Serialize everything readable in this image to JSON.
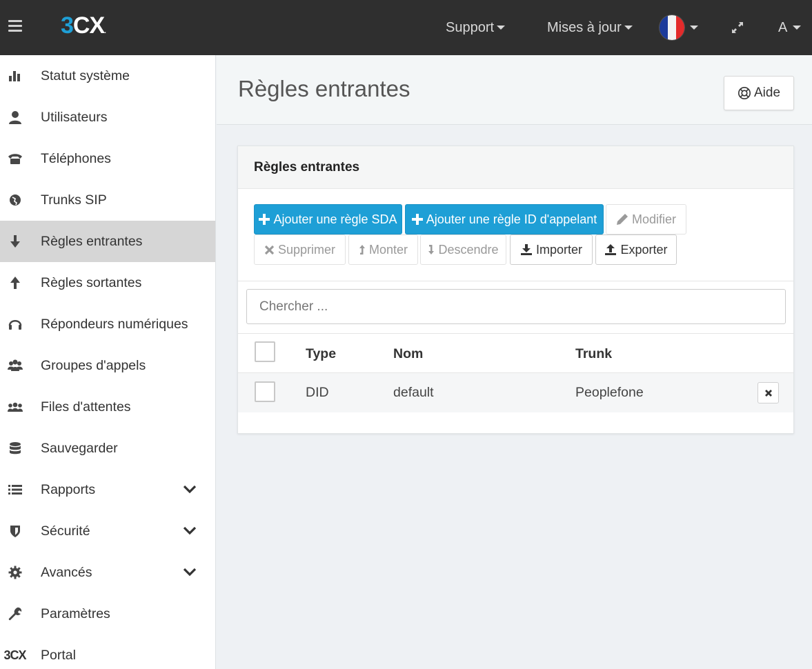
{
  "topbar": {
    "logo_prefix": "3",
    "logo_text": "CX",
    "logo_dot": ".",
    "support_label": "Support",
    "updates_label": "Mises à jour",
    "user_label": "A",
    "language_flag": "fr-flag-icon"
  },
  "sidebar": {
    "items": [
      {
        "label": "Statut système",
        "icon": "bar-chart-icon"
      },
      {
        "label": "Utilisateurs",
        "icon": "user-icon"
      },
      {
        "label": "Téléphones",
        "icon": "phone-icon"
      },
      {
        "label": "Trunks SIP",
        "icon": "globe-icon"
      },
      {
        "label": "Règles entrantes",
        "icon": "arrow-down-icon",
        "active": true
      },
      {
        "label": "Règles sortantes",
        "icon": "arrow-up-icon"
      },
      {
        "label": "Répondeurs numériques",
        "icon": "headset-icon"
      },
      {
        "label": "Groupes d'appels",
        "icon": "group-icon"
      },
      {
        "label": "Files d'attentes",
        "icon": "queue-icon"
      },
      {
        "label": "Sauvegarder",
        "icon": "database-icon"
      },
      {
        "label": "Rapports",
        "icon": "list-icon",
        "expandable": true
      },
      {
        "label": "Sécurité",
        "icon": "shield-icon",
        "expandable": true
      },
      {
        "label": "Avancés",
        "icon": "gear-icon",
        "expandable": true
      },
      {
        "label": "Paramètres",
        "icon": "wrench-icon"
      },
      {
        "label": "Portal",
        "icon": "3cx-logo-icon",
        "icon_text": "3CX"
      }
    ]
  },
  "header": {
    "title": "Règles entrantes",
    "help_label": "Aide"
  },
  "panel": {
    "title": "Règles entrantes",
    "buttons": {
      "add_sda": "Ajouter une règle SDA",
      "add_caller_id": "Ajouter une règle ID d'appelant",
      "edit": "Modifier",
      "delete": "Supprimer",
      "move_up": "Monter",
      "move_down": "Descendre",
      "import": "Importer",
      "export": "Exporter"
    },
    "search_placeholder": "Chercher ...",
    "table": {
      "columns": [
        "Type",
        "Nom",
        "Trunk"
      ],
      "rows": [
        {
          "type": "DID",
          "name": "default",
          "trunk": "Peoplefone"
        }
      ]
    }
  },
  "colors": {
    "topbar_bg": "#2f2f2f",
    "accent": "#1e9fd6",
    "active_nav_bg": "#d6d6d6",
    "page_bg": "#eef1f4"
  }
}
